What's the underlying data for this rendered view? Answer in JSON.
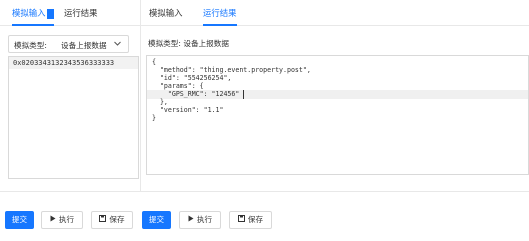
{
  "left_panel": {
    "tabs": [
      {
        "label": "模拟输入",
        "active": true
      },
      {
        "label": "运行结果",
        "active": false
      }
    ],
    "type_select": {
      "label": "模拟类型:",
      "value": "设备上报数据"
    },
    "hex_payload": "0x0203343132343536333333"
  },
  "right_panel": {
    "tabs": [
      {
        "label": "模拟输入",
        "active": false
      },
      {
        "label": "运行结果",
        "active": true
      }
    ],
    "type_line": "模拟类型: 设备上报数据",
    "code_lines": [
      "{",
      "  \"method\": \"thing.event.property.post\",",
      "  \"id\": \"554256254\",",
      "  \"params\": {",
      "    \"GPS_RMC\": \"12456\"",
      "  },",
      "  \"version\": \"1.1\"",
      "}"
    ]
  },
  "buttons": {
    "left": {
      "submit": "提交",
      "run": "执行",
      "save": "保存"
    },
    "right": {
      "submit": "提交",
      "run": "执行",
      "save": "保存"
    }
  },
  "icons": {
    "run": "play-icon",
    "save": "save-icon",
    "select": "chevron-down-icon"
  },
  "colors": {
    "accent": "#1677ff",
    "border": "#d9d9d9",
    "highlight_line": "#f0f0f0"
  }
}
